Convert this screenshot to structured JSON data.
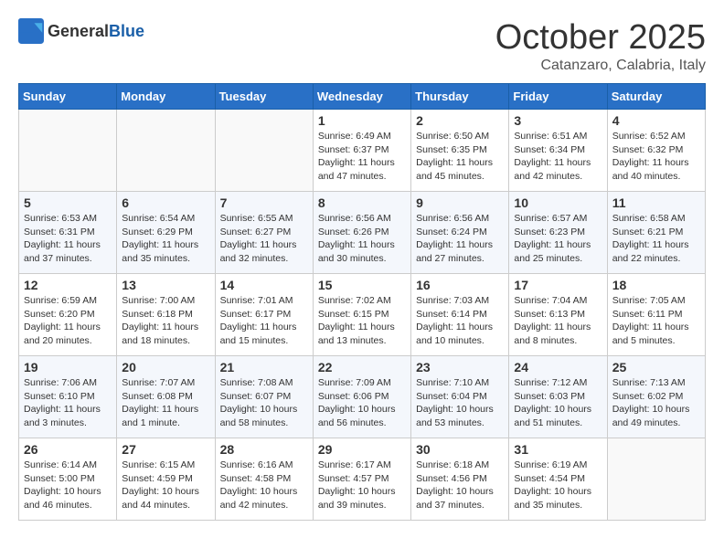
{
  "header": {
    "logo_general": "General",
    "logo_blue": "Blue",
    "month": "October 2025",
    "location": "Catanzaro, Calabria, Italy"
  },
  "weekdays": [
    "Sunday",
    "Monday",
    "Tuesday",
    "Wednesday",
    "Thursday",
    "Friday",
    "Saturday"
  ],
  "weeks": [
    [
      {
        "day": "",
        "info": ""
      },
      {
        "day": "",
        "info": ""
      },
      {
        "day": "",
        "info": ""
      },
      {
        "day": "1",
        "info": "Sunrise: 6:49 AM\nSunset: 6:37 PM\nDaylight: 11 hours\nand 47 minutes."
      },
      {
        "day": "2",
        "info": "Sunrise: 6:50 AM\nSunset: 6:35 PM\nDaylight: 11 hours\nand 45 minutes."
      },
      {
        "day": "3",
        "info": "Sunrise: 6:51 AM\nSunset: 6:34 PM\nDaylight: 11 hours\nand 42 minutes."
      },
      {
        "day": "4",
        "info": "Sunrise: 6:52 AM\nSunset: 6:32 PM\nDaylight: 11 hours\nand 40 minutes."
      }
    ],
    [
      {
        "day": "5",
        "info": "Sunrise: 6:53 AM\nSunset: 6:31 PM\nDaylight: 11 hours\nand 37 minutes."
      },
      {
        "day": "6",
        "info": "Sunrise: 6:54 AM\nSunset: 6:29 PM\nDaylight: 11 hours\nand 35 minutes."
      },
      {
        "day": "7",
        "info": "Sunrise: 6:55 AM\nSunset: 6:27 PM\nDaylight: 11 hours\nand 32 minutes."
      },
      {
        "day": "8",
        "info": "Sunrise: 6:56 AM\nSunset: 6:26 PM\nDaylight: 11 hours\nand 30 minutes."
      },
      {
        "day": "9",
        "info": "Sunrise: 6:56 AM\nSunset: 6:24 PM\nDaylight: 11 hours\nand 27 minutes."
      },
      {
        "day": "10",
        "info": "Sunrise: 6:57 AM\nSunset: 6:23 PM\nDaylight: 11 hours\nand 25 minutes."
      },
      {
        "day": "11",
        "info": "Sunrise: 6:58 AM\nSunset: 6:21 PM\nDaylight: 11 hours\nand 22 minutes."
      }
    ],
    [
      {
        "day": "12",
        "info": "Sunrise: 6:59 AM\nSunset: 6:20 PM\nDaylight: 11 hours\nand 20 minutes."
      },
      {
        "day": "13",
        "info": "Sunrise: 7:00 AM\nSunset: 6:18 PM\nDaylight: 11 hours\nand 18 minutes."
      },
      {
        "day": "14",
        "info": "Sunrise: 7:01 AM\nSunset: 6:17 PM\nDaylight: 11 hours\nand 15 minutes."
      },
      {
        "day": "15",
        "info": "Sunrise: 7:02 AM\nSunset: 6:15 PM\nDaylight: 11 hours\nand 13 minutes."
      },
      {
        "day": "16",
        "info": "Sunrise: 7:03 AM\nSunset: 6:14 PM\nDaylight: 11 hours\nand 10 minutes."
      },
      {
        "day": "17",
        "info": "Sunrise: 7:04 AM\nSunset: 6:13 PM\nDaylight: 11 hours\nand 8 minutes."
      },
      {
        "day": "18",
        "info": "Sunrise: 7:05 AM\nSunset: 6:11 PM\nDaylight: 11 hours\nand 5 minutes."
      }
    ],
    [
      {
        "day": "19",
        "info": "Sunrise: 7:06 AM\nSunset: 6:10 PM\nDaylight: 11 hours\nand 3 minutes."
      },
      {
        "day": "20",
        "info": "Sunrise: 7:07 AM\nSunset: 6:08 PM\nDaylight: 11 hours\nand 1 minute."
      },
      {
        "day": "21",
        "info": "Sunrise: 7:08 AM\nSunset: 6:07 PM\nDaylight: 10 hours\nand 58 minutes."
      },
      {
        "day": "22",
        "info": "Sunrise: 7:09 AM\nSunset: 6:06 PM\nDaylight: 10 hours\nand 56 minutes."
      },
      {
        "day": "23",
        "info": "Sunrise: 7:10 AM\nSunset: 6:04 PM\nDaylight: 10 hours\nand 53 minutes."
      },
      {
        "day": "24",
        "info": "Sunrise: 7:12 AM\nSunset: 6:03 PM\nDaylight: 10 hours\nand 51 minutes."
      },
      {
        "day": "25",
        "info": "Sunrise: 7:13 AM\nSunset: 6:02 PM\nDaylight: 10 hours\nand 49 minutes."
      }
    ],
    [
      {
        "day": "26",
        "info": "Sunrise: 6:14 AM\nSunset: 5:00 PM\nDaylight: 10 hours\nand 46 minutes."
      },
      {
        "day": "27",
        "info": "Sunrise: 6:15 AM\nSunset: 4:59 PM\nDaylight: 10 hours\nand 44 minutes."
      },
      {
        "day": "28",
        "info": "Sunrise: 6:16 AM\nSunset: 4:58 PM\nDaylight: 10 hours\nand 42 minutes."
      },
      {
        "day": "29",
        "info": "Sunrise: 6:17 AM\nSunset: 4:57 PM\nDaylight: 10 hours\nand 39 minutes."
      },
      {
        "day": "30",
        "info": "Sunrise: 6:18 AM\nSunset: 4:56 PM\nDaylight: 10 hours\nand 37 minutes."
      },
      {
        "day": "31",
        "info": "Sunrise: 6:19 AM\nSunset: 4:54 PM\nDaylight: 10 hours\nand 35 minutes."
      },
      {
        "day": "",
        "info": ""
      }
    ]
  ]
}
